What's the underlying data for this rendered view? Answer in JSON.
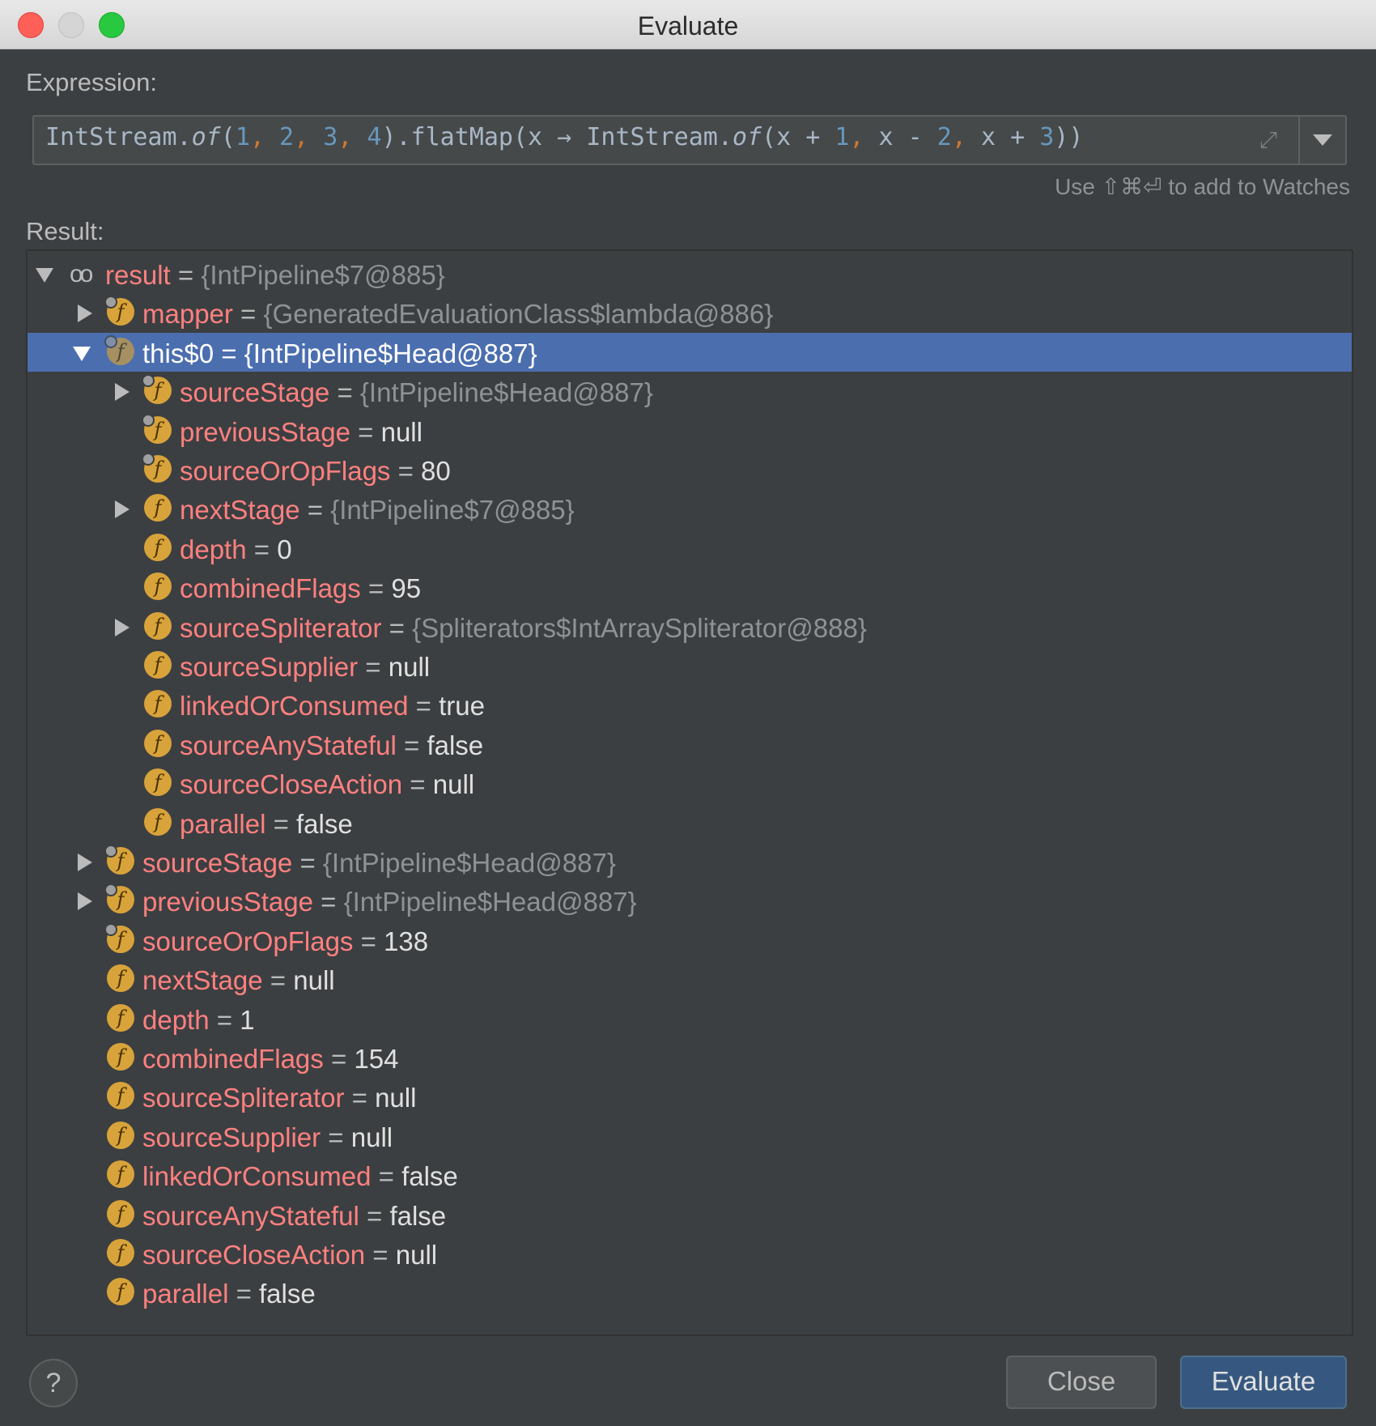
{
  "window": {
    "title": "Evaluate"
  },
  "expression": {
    "label": "Expression:",
    "parts": {
      "p1": "IntStream.",
      "p2": "of",
      "p3": "(",
      "n1": "1",
      "c1": ",",
      "n2": "2",
      "c2": ",",
      "n3": "3",
      "c3": ",",
      "n4": "4",
      "p4": ").flatMap(x → IntStream.",
      "p5": "of",
      "p6": "(x + ",
      "n5": "1",
      "c4": ",",
      "p7": " x - ",
      "n6": "2",
      "c5": ",",
      "p8": " x + ",
      "n7": "3",
      "p9": "))"
    },
    "hint": "Use ⇧⌘⏎ to add to Watches"
  },
  "result": {
    "label": "Result:",
    "rows": [
      {
        "name": "result",
        "eq": " = ",
        "value": "{IntPipeline$7@885}"
      },
      {
        "name": "mapper",
        "eq": " = ",
        "value": "{GeneratedEvaluationClass$lambda@886}"
      },
      {
        "name": "this$0",
        "eq": " = ",
        "value": "{IntPipeline$Head@887}"
      },
      {
        "name": "sourceStage",
        "eq": " = ",
        "value": "{IntPipeline$Head@887}"
      },
      {
        "name": "previousStage",
        "eq": " = ",
        "value": "null"
      },
      {
        "name": "sourceOrOpFlags",
        "eq": " = ",
        "value": "80"
      },
      {
        "name": "nextStage",
        "eq": " = ",
        "value": "{IntPipeline$7@885}"
      },
      {
        "name": "depth",
        "eq": " = ",
        "value": "0"
      },
      {
        "name": "combinedFlags",
        "eq": " = ",
        "value": "95"
      },
      {
        "name": "sourceSpliterator",
        "eq": " = ",
        "value": "{Spliterators$IntArraySpliterator@888}"
      },
      {
        "name": "sourceSupplier",
        "eq": " = ",
        "value": "null"
      },
      {
        "name": "linkedOrConsumed",
        "eq": " = ",
        "value": "true"
      },
      {
        "name": "sourceAnyStateful",
        "eq": " = ",
        "value": "false"
      },
      {
        "name": "sourceCloseAction",
        "eq": " = ",
        "value": "null"
      },
      {
        "name": "parallel",
        "eq": " = ",
        "value": "false"
      },
      {
        "name": "sourceStage",
        "eq": " = ",
        "value": "{IntPipeline$Head@887}"
      },
      {
        "name": "previousStage",
        "eq": " = ",
        "value": "{IntPipeline$Head@887}"
      },
      {
        "name": "sourceOrOpFlags",
        "eq": " = ",
        "value": "138"
      },
      {
        "name": "nextStage",
        "eq": " = ",
        "value": "null"
      },
      {
        "name": "depth",
        "eq": " = ",
        "value": "1"
      },
      {
        "name": "combinedFlags",
        "eq": " = ",
        "value": "154"
      },
      {
        "name": "sourceSpliterator",
        "eq": " = ",
        "value": "null"
      },
      {
        "name": "sourceSupplier",
        "eq": " = ",
        "value": "null"
      },
      {
        "name": "linkedOrConsumed",
        "eq": " = ",
        "value": "false"
      },
      {
        "name": "sourceAnyStateful",
        "eq": " = ",
        "value": "false"
      },
      {
        "name": "sourceCloseAction",
        "eq": " = ",
        "value": "null"
      },
      {
        "name": "parallel",
        "eq": " = ",
        "value": "false"
      }
    ]
  },
  "icons": {
    "field": "field-icon",
    "watch": "glasses-icon",
    "help": "help-icon",
    "expand": "expand-icon"
  },
  "buttons": {
    "help": "?",
    "close": "Close",
    "evaluate": "Evaluate"
  },
  "colors": {
    "selection": "#4b6eaf",
    "field_name": "#ff8080",
    "field_icon": "#d8a33a",
    "evaluate_button": "#365880"
  }
}
